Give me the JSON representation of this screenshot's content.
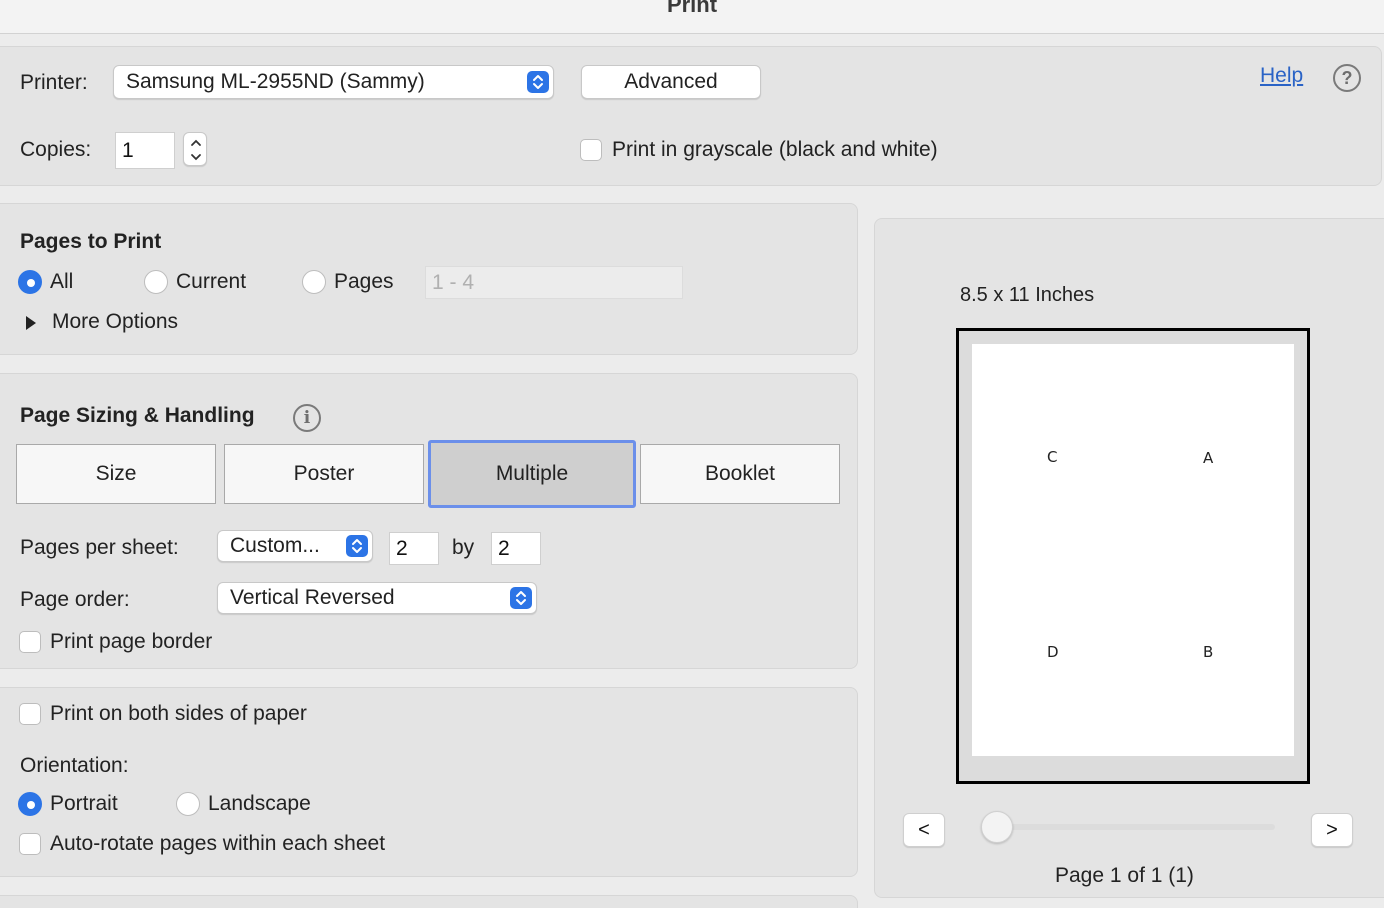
{
  "window": {
    "title": "Print"
  },
  "printer": {
    "label": "Printer:",
    "selected": "Samsung ML-2955ND (Sammy)",
    "advanced_label": "Advanced",
    "help_label": "Help"
  },
  "copies": {
    "label": "Copies:",
    "value": "1",
    "grayscale_label": "Print in grayscale (black and white)",
    "grayscale_checked": false
  },
  "pages_to_print": {
    "heading": "Pages to Print",
    "options": [
      "All",
      "Current",
      "Pages"
    ],
    "selected": "All",
    "range_placeholder": "1 - 4",
    "more_options_label": "More Options"
  },
  "page_sizing": {
    "heading": "Page Sizing & Handling",
    "modes": [
      "Size",
      "Poster",
      "Multiple",
      "Booklet"
    ],
    "active_mode": "Multiple",
    "pages_per_sheet_label": "Pages per sheet:",
    "pages_per_sheet_value": "Custom...",
    "cols": "2",
    "by_label": "by",
    "rows": "2",
    "page_order_label": "Page order:",
    "page_order_value": "Vertical Reversed",
    "print_border_label": "Print page border"
  },
  "duplex": {
    "both_sides_label": "Print on both sides of paper",
    "orientation_label": "Orientation:",
    "orientations": [
      "Portrait",
      "Landscape"
    ],
    "selected_orientation": "Portrait",
    "auto_rotate_label": "Auto-rotate pages within each sheet"
  },
  "preview": {
    "paper_size": "8.5 x 11 Inches",
    "page_letters": [
      "C",
      "A",
      "D",
      "B"
    ],
    "prev_label": "<",
    "next_label": ">",
    "page_status": "Page 1 of 1 (1)"
  },
  "colors": {
    "accent": "#2c74e6",
    "link": "#2a63c6",
    "active_segment_border": "#6b8fea"
  }
}
